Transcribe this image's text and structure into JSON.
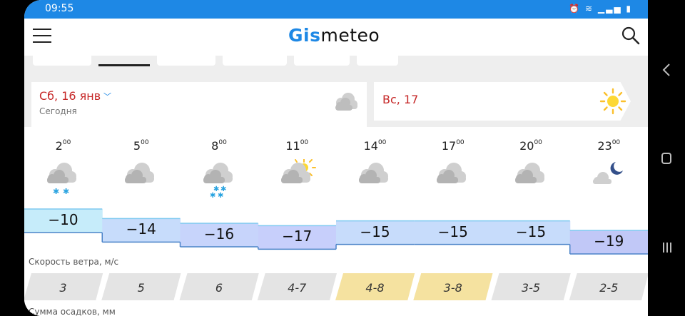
{
  "status_bar": {
    "time": "09:55",
    "icons": [
      "alarm-icon",
      "wifi-icon",
      "signal-icon",
      "battery-icon"
    ]
  },
  "app": {
    "logo_accent": "Gis",
    "logo_rest": "meteo",
    "brand_color": "#1e88e5"
  },
  "days": {
    "today": {
      "label": "Сб, 16 янв",
      "sub": "Сегодня",
      "icon": "cloudy-icon"
    },
    "next": {
      "label": "Вс, 17",
      "icon": "sun-icon"
    }
  },
  "hourly": [
    {
      "hour": "2",
      "minutes": "00",
      "icon": "cloud-light-snow",
      "temp": "−10",
      "temp_value": -10,
      "wind": "3",
      "wind_level": "calm"
    },
    {
      "hour": "5",
      "minutes": "00",
      "icon": "cloud",
      "temp": "−14",
      "temp_value": -14,
      "wind": "5",
      "wind_level": "calm"
    },
    {
      "hour": "8",
      "minutes": "00",
      "icon": "cloud-snow",
      "temp": "−16",
      "temp_value": -16,
      "wind": "6",
      "wind_level": "calm"
    },
    {
      "hour": "11",
      "minutes": "00",
      "icon": "cloud-sun",
      "temp": "−17",
      "temp_value": -17,
      "wind": "4-7",
      "wind_level": "calm"
    },
    {
      "hour": "14",
      "minutes": "00",
      "icon": "cloud",
      "temp": "−15",
      "temp_value": -15,
      "wind": "4-8",
      "wind_level": "moderate"
    },
    {
      "hour": "17",
      "minutes": "00",
      "icon": "cloud",
      "temp": "−15",
      "temp_value": -15,
      "wind": "3-8",
      "wind_level": "moderate"
    },
    {
      "hour": "20",
      "minutes": "00",
      "icon": "cloud",
      "temp": "−15",
      "temp_value": -15,
      "wind": "3-5",
      "wind_level": "calm"
    },
    {
      "hour": "23",
      "minutes": "00",
      "icon": "cloud-moon",
      "temp": "−19",
      "temp_value": -19,
      "wind": "2-5",
      "wind_level": "calm"
    }
  ],
  "sections": {
    "wind_title": "Скорость ветра, м/с",
    "precip_title": "Сумма осадков, мм"
  },
  "colors": {
    "temp_band": [
      "#c6ecfa",
      "#c7dcfb",
      "#c7d4fb",
      "#c7cffb",
      "#c7dcfb",
      "#c7dcfb",
      "#c7dcfb",
      "#c1c8f7"
    ],
    "wind_calm": "#e4e4e4",
    "wind_moderate": "#f5e2a0"
  }
}
